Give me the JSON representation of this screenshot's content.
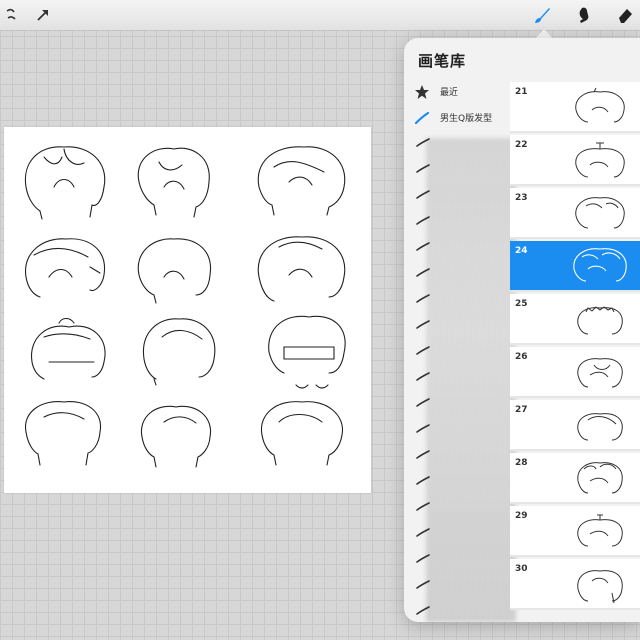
{
  "toolbar": {
    "left_tools": [
      {
        "name": "adjustments",
        "icon": "adjustments-icon"
      },
      {
        "name": "transform",
        "icon": "arrow-icon"
      }
    ],
    "right_tools": [
      {
        "name": "brush",
        "icon": "brush-icon",
        "active": true
      },
      {
        "name": "smudge",
        "icon": "smudge-icon"
      },
      {
        "name": "eraser",
        "icon": "eraser-icon"
      }
    ],
    "active_color": "#1b8cf0"
  },
  "panel": {
    "title": "画笔库",
    "categories": [
      {
        "label": "最近",
        "icon": "star-icon"
      },
      {
        "label": "男生Q版发型",
        "icon": "brush-stroke-icon",
        "active": true
      }
    ],
    "brushes": [
      {
        "number": "21"
      },
      {
        "number": "22"
      },
      {
        "number": "23"
      },
      {
        "number": "24",
        "selected": true
      },
      {
        "number": "25"
      },
      {
        "number": "26"
      },
      {
        "number": "27"
      },
      {
        "number": "28"
      },
      {
        "number": "29"
      },
      {
        "number": "30"
      }
    ]
  }
}
